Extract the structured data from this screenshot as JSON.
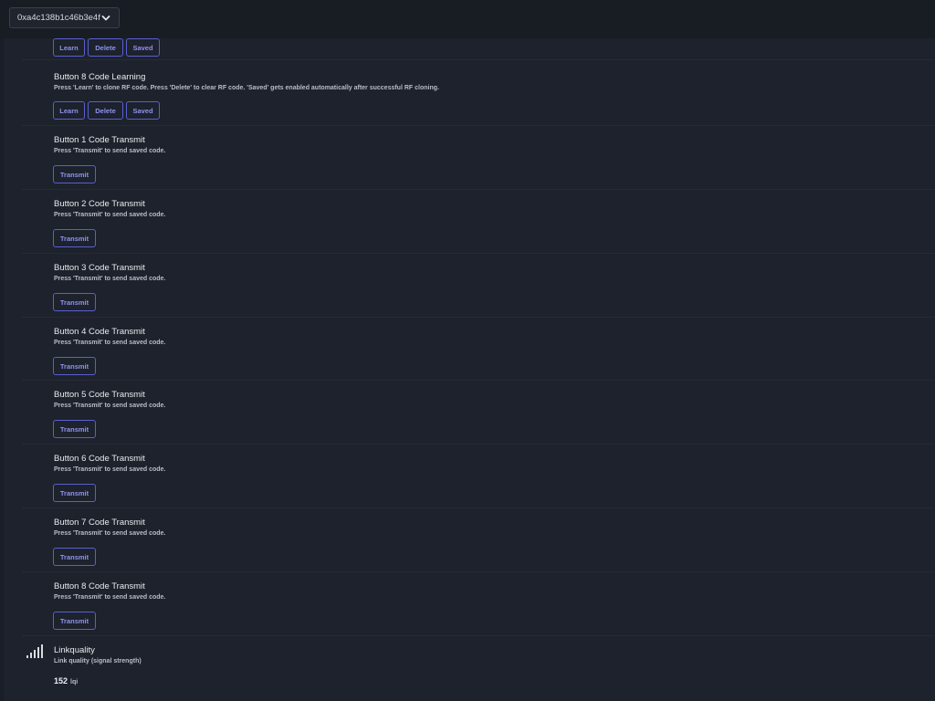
{
  "header": {
    "device_id": "0xa4c138b1c46b3e4f",
    "dropdown_icon": "chevron-down-icon"
  },
  "learning_top": {
    "buttons": {
      "learn": "Learn",
      "delete": "Delete",
      "saved": "Saved"
    }
  },
  "learning_8": {
    "title": "Button 8 Code Learning",
    "description": "Press 'Learn' to clone RF code. Press 'Delete' to clear RF code. 'Saved' gets enabled automatically after successful RF cloning.",
    "buttons": {
      "learn": "Learn",
      "delete": "Delete",
      "saved": "Saved"
    }
  },
  "transmit": [
    {
      "title": "Button 1 Code Transmit",
      "description": "Press 'Transmit' to send saved code.",
      "button": "Transmit"
    },
    {
      "title": "Button 2 Code Transmit",
      "description": "Press 'Transmit' to send saved code.",
      "button": "Transmit"
    },
    {
      "title": "Button 3 Code Transmit",
      "description": "Press 'Transmit' to send saved code.",
      "button": "Transmit"
    },
    {
      "title": "Button 4 Code Transmit",
      "description": "Press 'Transmit' to send saved code.",
      "button": "Transmit"
    },
    {
      "title": "Button 5 Code Transmit",
      "description": "Press 'Transmit' to send saved code.",
      "button": "Transmit"
    },
    {
      "title": "Button 6 Code Transmit",
      "description": "Press 'Transmit' to send saved code.",
      "button": "Transmit"
    },
    {
      "title": "Button 7 Code Transmit",
      "description": "Press 'Transmit' to send saved code.",
      "button": "Transmit"
    },
    {
      "title": "Button 8 Code Transmit",
      "description": "Press 'Transmit' to send saved code.",
      "button": "Transmit"
    }
  ],
  "linkquality": {
    "icon": "signal-strength-icon",
    "title": "Linkquality",
    "description": "Link quality (signal strength)",
    "value": "152",
    "unit": "lqi"
  },
  "colors": {
    "background": "#1d222c",
    "topbar": "#181c23",
    "button_border": "#5a5fcf",
    "button_text": "#8d92f0"
  }
}
